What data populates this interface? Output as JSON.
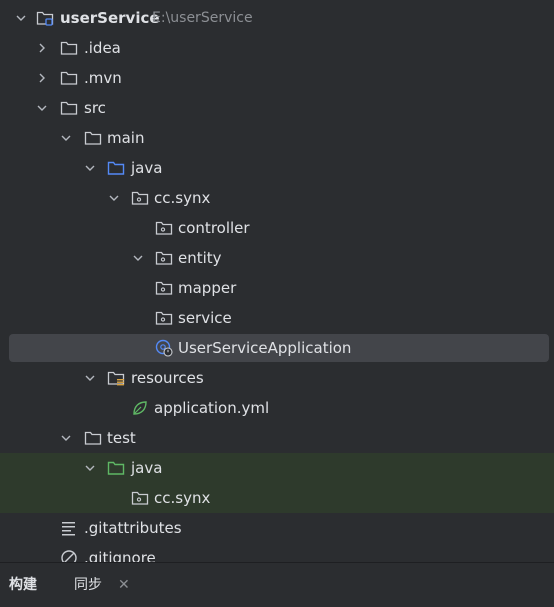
{
  "tree": {
    "root": {
      "name": "userService",
      "path": "E:\\userService"
    },
    "idea": ".idea",
    "mvn": ".mvn",
    "src": "src",
    "main": "main",
    "java": "java",
    "package": "cc.synx",
    "controller": "controller",
    "entity": "entity",
    "mapper": "mapper",
    "service": "service",
    "app_class": "UserServiceApplication",
    "resources": "resources",
    "app_yml": "application.yml",
    "test": "test",
    "test_java": "java",
    "test_package": "cc.synx",
    "gitattributes": ".gitattributes",
    "gitignore": ".gitignore"
  },
  "bottom_bar": {
    "tab_build": "构建",
    "tab_sync": "同步",
    "close_glyph": "✕"
  },
  "colors": {
    "background": "#2b2d30",
    "selection": "#43454a",
    "test_row": "#2e3a2c",
    "java_folder": "#548af7",
    "test_folder": "#5fb865",
    "spring_green": "#5fb865"
  }
}
